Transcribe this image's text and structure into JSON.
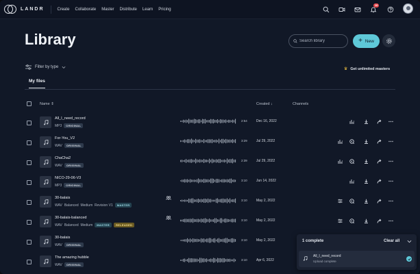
{
  "brand": {
    "name": "LANDR"
  },
  "nav": {
    "links": [
      "Create",
      "Collaborate",
      "Master",
      "Distribute",
      "Learn",
      "Pricing"
    ],
    "notification_count": "16"
  },
  "library": {
    "title": "Library",
    "search_placeholder": "Search library",
    "new_label": "New",
    "filter_label": "Filter by type",
    "unlimited_label": "Get unlimited masters",
    "tab": "My files"
  },
  "table": {
    "headers": {
      "name": "Name",
      "created": "Created",
      "channels": "Channels"
    },
    "rows": [
      {
        "title": "All_I_need_record",
        "format": "MP3",
        "tags": [
          "ORIGINAL"
        ],
        "duration": "2:54",
        "date": "Dec 16, 2022",
        "group": false,
        "actions": [
          "chart",
          "download",
          "share",
          "more"
        ]
      },
      {
        "title": "For-You_V2",
        "format": "WAV",
        "tags": [
          "ORIGINAL"
        ],
        "duration": "3:29",
        "date": "Jul 29, 2022",
        "group": false,
        "actions": [
          "chart",
          "master",
          "download",
          "share",
          "more"
        ]
      },
      {
        "title": "ChaCha2",
        "format": "WAV",
        "tags": [
          "ORIGINAL"
        ],
        "duration": "2:39",
        "date": "Jul 29, 2022",
        "group": false,
        "actions": [
          "chart",
          "master",
          "download",
          "share",
          "more"
        ]
      },
      {
        "title": "NICO-29-06-V3",
        "format": "MP3",
        "tags": [
          "ORIGINAL"
        ],
        "duration": "3:10",
        "date": "Jun 14, 2022",
        "group": false,
        "actions": [
          "chart",
          "download",
          "share",
          "more"
        ]
      },
      {
        "title": "30-balais",
        "format": "WAV",
        "extra": "Balanced  Medium  Revision V1",
        "tags": [
          "MASTER"
        ],
        "duration": "3:10",
        "date": "May 2, 2022",
        "group": true,
        "actions": [
          "sliders",
          "master",
          "download",
          "share",
          "more"
        ]
      },
      {
        "title": "30-balais-balanced",
        "format": "WAV",
        "extra": "Balanced  Medium",
        "tags": [
          "MASTER",
          "RELEASED"
        ],
        "duration": "3:10",
        "date": "May 2, 2022",
        "group": true,
        "actions": [
          "sliders",
          "master",
          "download",
          "share",
          "more"
        ]
      },
      {
        "title": "30-balais",
        "format": "WAV",
        "tags": [
          "ORIGINAL"
        ],
        "duration": "3:10",
        "date": "May 2, 2022",
        "group": false,
        "actions": [
          "chart",
          "master",
          "download",
          "share",
          "more"
        ]
      },
      {
        "title": "The amazing hubble",
        "format": "WAV",
        "tags": [
          "ORIGINAL"
        ],
        "duration": "3:10",
        "date": "Apr 6, 2022",
        "group": false,
        "actions": [
          "chart",
          "master",
          "download",
          "share",
          "more"
        ]
      }
    ]
  },
  "upload": {
    "count_label": "1 complete",
    "clear_label": "Clear all",
    "item_title": "All_I_need_record",
    "item_status": "Upload complete"
  },
  "colors": {
    "accent": "#5ec8d8",
    "background": "#111827",
    "nav": "#0e1422",
    "released": "#f4dc88",
    "crown": "#f5c542"
  }
}
